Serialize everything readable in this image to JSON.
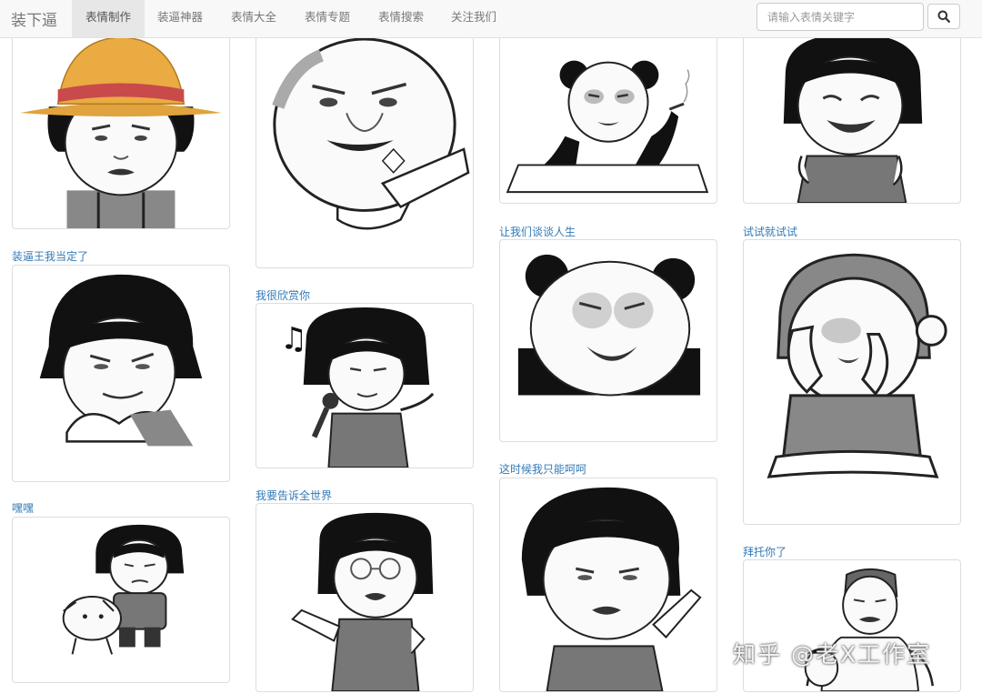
{
  "navbar": {
    "brand": "装下逼",
    "items": [
      {
        "label": "表情制作",
        "active": true
      },
      {
        "label": "装逼神器"
      },
      {
        "label": "表情大全"
      },
      {
        "label": "表情专题"
      },
      {
        "label": "表情搜索"
      },
      {
        "label": "关注我们"
      }
    ],
    "search": {
      "placeholder": "请输入表情关键字",
      "icon": "search-icon"
    }
  },
  "grid": {
    "col1": [
      {
        "caption": "",
        "image": "straw-hat-mushroom-head-meme"
      },
      {
        "caption": "装逼王我当定了",
        "image": "smug-mushroom-head-meme"
      },
      {
        "caption": "嘿嘿",
        "image": "mushroom-head-with-puppy-meme"
      }
    ],
    "col2": [
      {
        "caption": "",
        "image": "round-face-pointing-meme"
      },
      {
        "caption": "我很欣赏你",
        "image": "singing-mushroom-head-meme"
      },
      {
        "caption": "我要告诉全世界",
        "image": "mushroom-head-with-glasses-meme"
      }
    ],
    "col3": [
      {
        "caption": "",
        "image": "panda-smoking-at-table-meme"
      },
      {
        "caption": "让我们谈谈人生",
        "image": "laughing-panda-meme"
      },
      {
        "caption": "这时候我只能呵呵",
        "image": "pointing-mushroom-head-meme"
      }
    ],
    "col4": [
      {
        "caption": "",
        "image": "crying-mushroom-head-meme"
      },
      {
        "caption": "试试就试试",
        "image": "kid-covering-face-meme"
      },
      {
        "caption": "拜托你了",
        "image": "mohawk-man-meme"
      }
    ]
  },
  "watermark": "知乎 @老X工作室",
  "colors": {
    "link": "#337ab7",
    "navbar_bg": "#f8f8f8",
    "border": "#dddddd"
  }
}
